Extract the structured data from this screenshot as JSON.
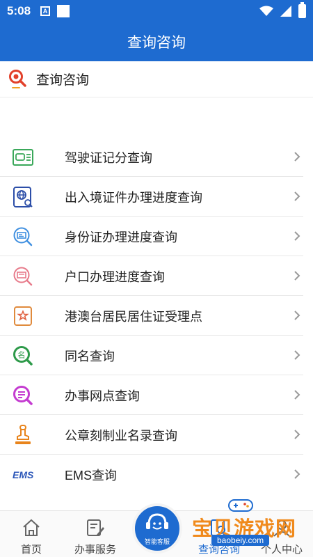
{
  "status_bar": {
    "time": "5:08",
    "notification_letter": "A"
  },
  "header": {
    "title": "查询咨询"
  },
  "section": {
    "title": "查询咨询"
  },
  "items": [
    {
      "label": "驾驶证记分查询",
      "icon": "license-icon"
    },
    {
      "label": "出入境证件办理进度查询",
      "icon": "passport-globe-icon"
    },
    {
      "label": "身份证办理进度查询",
      "icon": "id-card-search-icon"
    },
    {
      "label": "户口办理进度查询",
      "icon": "household-search-icon"
    },
    {
      "label": "港澳台居民居住证受理点",
      "icon": "residence-permit-icon"
    },
    {
      "label": "同名查询",
      "icon": "same-name-search-icon"
    },
    {
      "label": "办事网点查询",
      "icon": "service-point-search-icon"
    },
    {
      "label": "公章刻制业名录查询",
      "icon": "seal-stamp-icon"
    },
    {
      "label": "EMS查询",
      "icon": "ems-icon"
    }
  ],
  "bottom_nav": {
    "home": "首页",
    "services": "办事服务",
    "center_service": "智能客服",
    "query": "查询咨询",
    "personal": "个人中心"
  },
  "watermark": {
    "text": "宝贝游戏网",
    "url": "baobeiy.com"
  },
  "colors": {
    "primary": "#1e6bd0",
    "watermark": "#f08a1c"
  }
}
